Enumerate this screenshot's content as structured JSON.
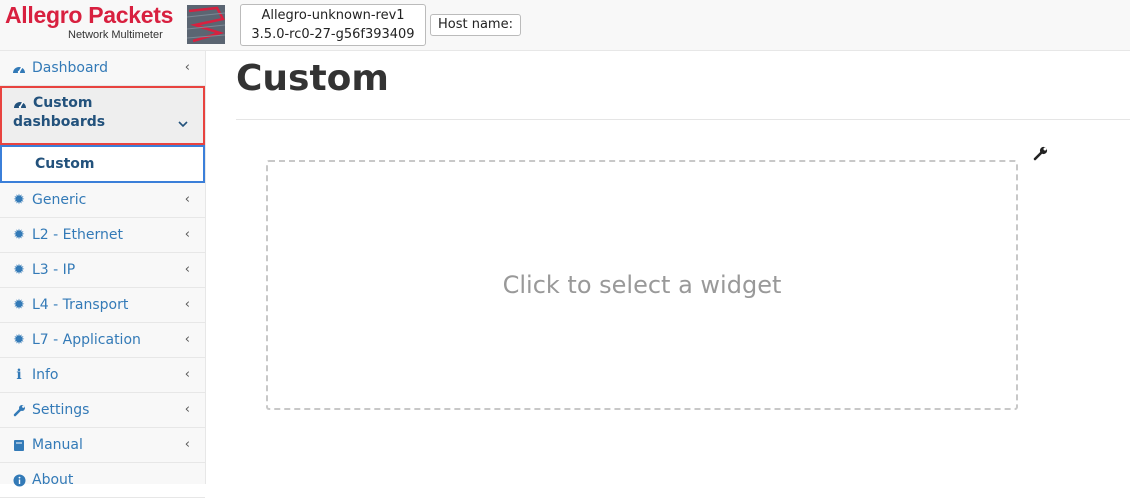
{
  "header": {
    "logo_main": "Allegro Packets",
    "logo_sub": "Network Multimeter",
    "version_line1": "Allegro-unknown-rev1",
    "version_line2": "3.5.0-rc0-27-g56f393409",
    "host_label": "Host name:"
  },
  "sidebar": {
    "items": [
      {
        "label": "Dashboard",
        "icon": "dashboard-icon"
      },
      {
        "label_line1": "Custom",
        "label_line2": "dashboards",
        "icon": "dashboard-icon"
      },
      {
        "label": "Custom"
      },
      {
        "label": "Generic",
        "icon": "gear-icon"
      },
      {
        "label": "L2 - Ethernet",
        "icon": "gear-icon"
      },
      {
        "label": "L3 - IP",
        "icon": "gear-icon"
      },
      {
        "label": "L4 - Transport",
        "icon": "gear-icon"
      },
      {
        "label": "L7 - Application",
        "icon": "gear-icon"
      },
      {
        "label": "Info",
        "icon": "info-icon"
      },
      {
        "label": "Settings",
        "icon": "wrench-icon"
      },
      {
        "label": "Manual",
        "icon": "book-icon"
      },
      {
        "label": "About",
        "icon": "info-circle-icon"
      }
    ]
  },
  "main": {
    "title": "Custom",
    "widget_placeholder": "Click to select a widget"
  },
  "colors": {
    "brand": "#d8203f",
    "link": "#337ab7",
    "active_border": "#e8433f",
    "sub_active_border": "#3b7fd9"
  }
}
